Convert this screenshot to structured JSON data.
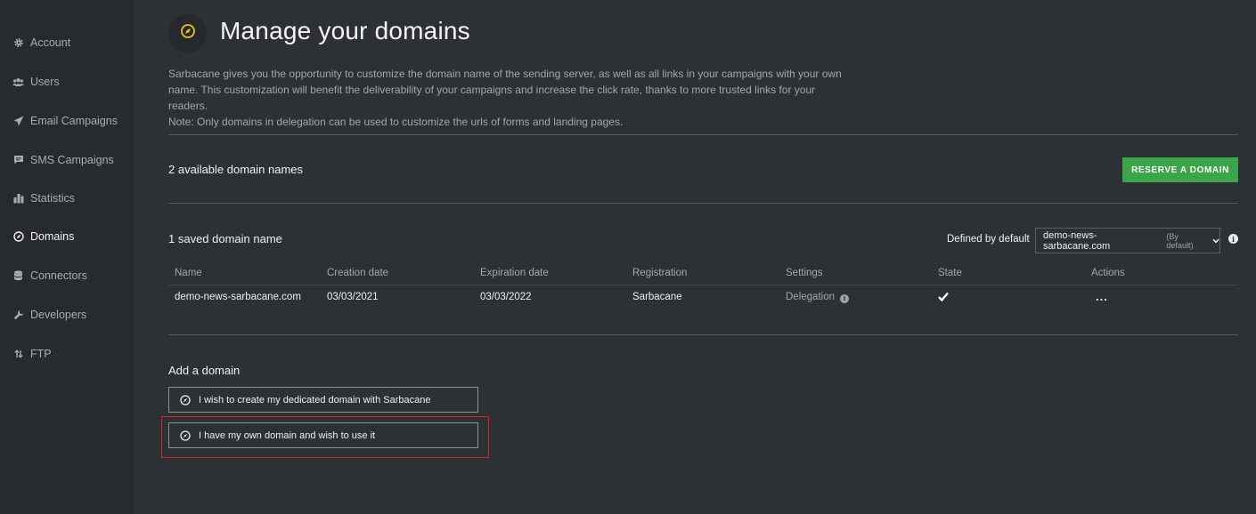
{
  "sidebar": {
    "items": [
      {
        "label": "Account",
        "icon": "gear-icon"
      },
      {
        "label": "Users",
        "icon": "users-icon"
      },
      {
        "label": "Email Campaigns",
        "icon": "paper-plane-icon"
      },
      {
        "label": "SMS Campaigns",
        "icon": "chat-icon"
      },
      {
        "label": "Statistics",
        "icon": "bar-chart-icon"
      },
      {
        "label": "Domains",
        "icon": "compass-icon",
        "active": true
      },
      {
        "label": "Connectors",
        "icon": "database-icon"
      },
      {
        "label": "Developers",
        "icon": "wrench-icon"
      },
      {
        "label": "FTP",
        "icon": "transfer-icon"
      }
    ]
  },
  "header": {
    "title": "Manage your domains",
    "icon": "compass-icon",
    "accent_color": "#f0c419"
  },
  "intro": {
    "line1": "Sarbacane gives you the opportunity to customize the domain name of the sending server, as well as all links in your campaigns with your own",
    "line2": "name. This customization will benefit the deliverability of your campaigns and increase the click rate, thanks to more trusted links for your readers.",
    "line3": "Note: Only domains in delegation can be used to customize the urls of forms and landing pages."
  },
  "available": {
    "label": "2 available domain names",
    "button_label": "RESERVE A DOMAIN",
    "button_color": "#3ba54a"
  },
  "saved": {
    "label": "1 saved domain name",
    "default_label": "Defined by default",
    "default_value": "demo-news-sarbacane.com",
    "default_tag": "(By default)",
    "columns": [
      "Name",
      "Creation date",
      "Expiration date",
      "Registration",
      "Settings",
      "State",
      "Actions"
    ],
    "rows": [
      {
        "name": "demo-news-sarbacane.com",
        "creation": "03/03/2021",
        "expiration": "03/03/2022",
        "registration": "Sarbacane",
        "settings": "Delegation",
        "state": "checkmark-icon",
        "actions": "..."
      }
    ]
  },
  "add": {
    "label": "Add a domain",
    "options": [
      "I wish to create my dedicated domain with Sarbacane",
      "I have my own domain and wish to use it"
    ],
    "highlight_color": "#d32525"
  }
}
